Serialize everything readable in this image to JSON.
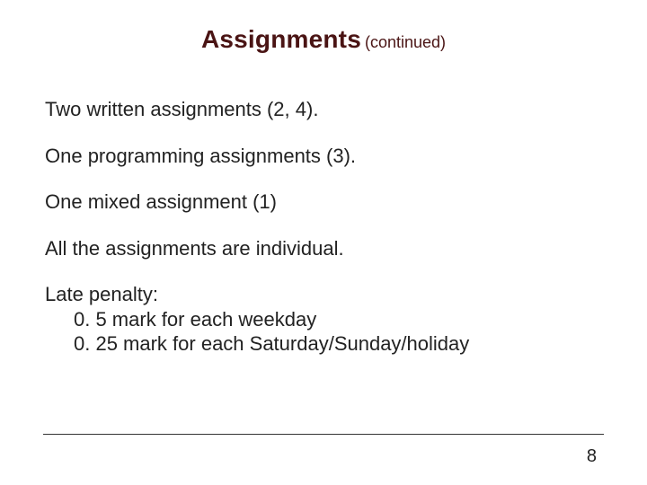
{
  "title": {
    "main": "Assignments",
    "sub": "(continued)"
  },
  "body": {
    "p1": "Two written assignments (2, 4).",
    "p2": "One programming assignments (3).",
    "p3": "One mixed assignment (1)",
    "p4": "All the assignments are individual.",
    "penalty_label": "Late penalty:",
    "penalty_line1": "0. 5 mark for each weekday",
    "penalty_line2": "0. 25 mark for each Saturday/Sunday/holiday"
  },
  "page_number": "8"
}
